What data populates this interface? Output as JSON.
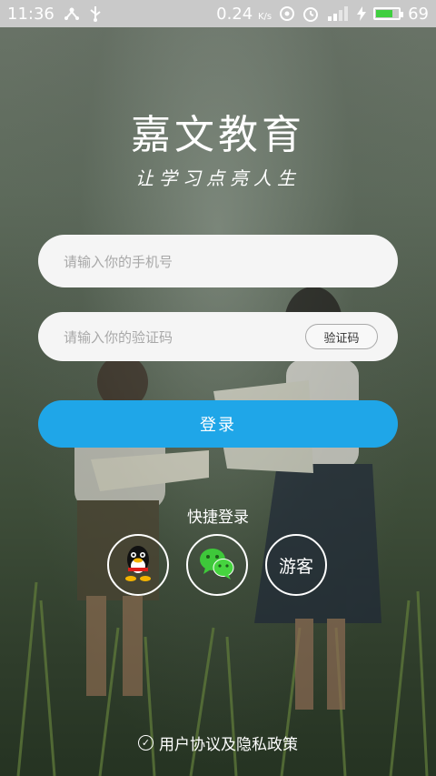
{
  "status_bar": {
    "time": "11:36",
    "speed": "0.24",
    "speed_unit": "K/s",
    "battery": "69",
    "battery_level": 0.69,
    "icons": [
      "usb-tree-icon",
      "usb-icon",
      "speed-icon",
      "sync-icon",
      "alarm-icon",
      "signal-icon",
      "charging-icon",
      "battery-icon"
    ]
  },
  "header": {
    "title": "嘉文教育",
    "slogan": "让学习点亮人生"
  },
  "form": {
    "phone_placeholder": "请输入你的手机号",
    "code_placeholder": "请输入你的验证码",
    "code_button": "验证码",
    "login_button": "登录"
  },
  "quick_login": {
    "label": "快捷登录",
    "guest": "游客",
    "icons": [
      "qq-icon",
      "wechat-icon"
    ]
  },
  "footer": {
    "agreement": "用户协议及隐私政策"
  },
  "colors": {
    "accent": "#1fa6e8",
    "input_bg": "#f5f5f5"
  }
}
